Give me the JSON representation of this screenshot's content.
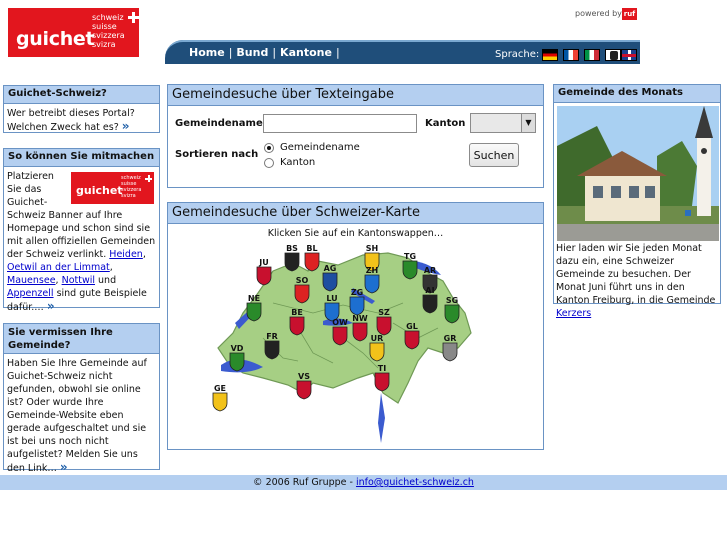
{
  "brand": {
    "logo_word": "guichet",
    "logo_langs": [
      "schweiz",
      "suisse",
      "svizzera",
      "svizra"
    ],
    "powered_by": "powered by",
    "powered_brand": "ruf"
  },
  "nav": {
    "links": [
      "Home",
      "Bund",
      "Kantone"
    ],
    "separator": "|",
    "sprache_label": "Sprache:",
    "flags": [
      "flag-de-icon",
      "flag-fr-icon",
      "flag-it-icon",
      "flag-rm-icon",
      "flag-en-icon"
    ]
  },
  "left": {
    "what": {
      "title": "Guichet-Schweiz?",
      "text": "Wer betreibt dieses Portal? Welchen Zweck hat es?"
    },
    "join": {
      "title": "So können Sie mitmachen",
      "text_before": "Platzieren Sie das Guichet-Schweiz Banner auf Ihre Homepage und schon sind sie mit allen offiziellen Gemeinden der Schweiz verlinkt.",
      "links": [
        "Heiden",
        "Oetwil an der Limmat",
        "Mauensee",
        "Nottwil",
        "Appenzell"
      ],
      "sep1": ", ",
      "sep2": ", ",
      "sep3": ", ",
      "and": " und ",
      "text_after": " sind gute Beispiele dafür.…"
    },
    "missing": {
      "title": "Sie vermissen Ihre Gemeinde?",
      "text": "Haben Sie Ihre Gemeinde auf Guichet-Schweiz nicht gefunden, obwohl sie online ist? Oder wurde Ihre Gemeinde-Website eben gerade aufgeschaltet und sie ist bei uns noch nicht aufgelistet? Melden Sie uns den Link…"
    }
  },
  "search_text": {
    "title": "Gemeindesuche über Texteingabe",
    "name_label": "Gemeindename",
    "name_value": "",
    "kanton_label": "Kanton",
    "kanton_value": "",
    "sort_label": "Sortieren nach",
    "sort_options": [
      "Gemeindename",
      "Kanton"
    ],
    "sort_selected": "Gemeindename",
    "button": "Suchen"
  },
  "search_map": {
    "title": "Gemeindesuche über Schweizer-Karte",
    "caption": "Klicken Sie auf ein Kantonswappen…",
    "cantons": [
      "SH",
      "BS",
      "BL",
      "TG",
      "JU",
      "AG",
      "ZH",
      "AR",
      "SO",
      "AI",
      "ZG",
      "SG",
      "NE",
      "LU",
      "SZ",
      "BE",
      "NW",
      "OW",
      "GL",
      "FR",
      "UR",
      "GR",
      "VD",
      "TI",
      "VS",
      "GE"
    ]
  },
  "month": {
    "title": "Gemeinde des Monats",
    "text": "Hier laden wir Sie jeden Monat dazu ein, eine Schweizer Gemeinde zu besuchen. Der Monat Juni führt uns in den Kanton Freiburg, in die Gemeinde ",
    "link": "Kerzers"
  },
  "footer": {
    "copyright": "© 2006 Ruf Gruppe - ",
    "email": "info@guichet-schweiz.ch"
  }
}
